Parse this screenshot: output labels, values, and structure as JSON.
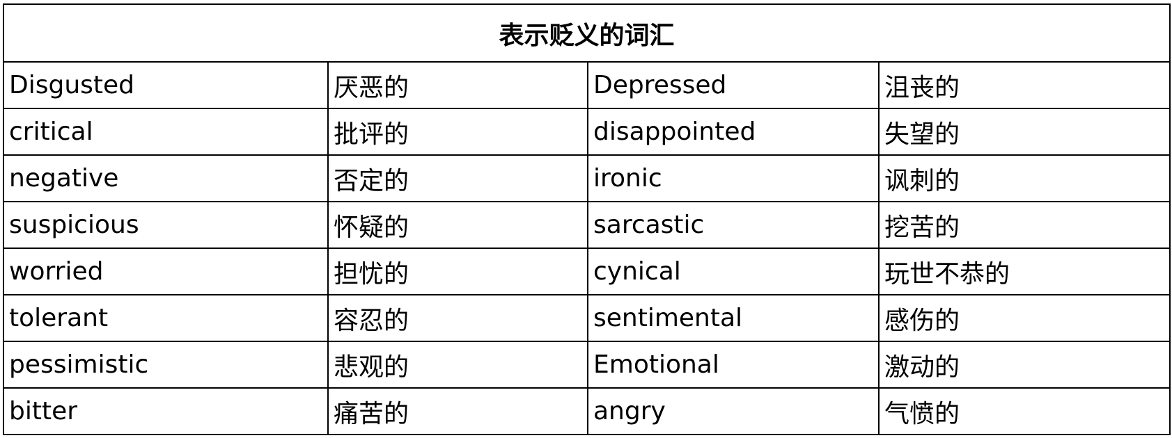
{
  "title": "表示贬义的词汇",
  "rows": [
    [
      "Disgusted",
      "厌恶的",
      "Depressed",
      "沮丧的"
    ],
    [
      "critical",
      "批评的",
      "disappointed",
      "失望的"
    ],
    [
      "negative",
      "否定的",
      "ironic",
      "讽刺的"
    ],
    [
      "suspicious",
      "怀疑的",
      "sarcastic",
      "挖苦的"
    ],
    [
      "worried",
      "担忧的",
      "cynical",
      "玩世不恭的"
    ],
    [
      "tolerant",
      "容忍的",
      "sentimental",
      "感伤的"
    ],
    [
      "pessimistic",
      "悲观的",
      "Emotional",
      "激动的"
    ],
    [
      "bitter",
      "痛苦的",
      "angry",
      "气愤的"
    ]
  ]
}
